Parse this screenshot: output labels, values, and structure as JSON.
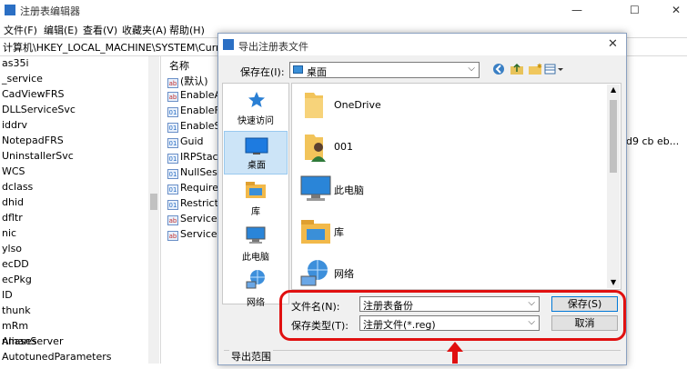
{
  "regedit": {
    "title": "注册表编辑器",
    "menu": [
      "文件(F)",
      "编辑(E)",
      "查看(V)",
      "收藏夹(A)",
      "帮助(H)"
    ],
    "address": "计算机\\HKEY_LOCAL_MACHINE\\SYSTEM\\CurrentCo",
    "tree_items": [
      "as35i",
      "_service",
      "CadViewFRS",
      "DLLServiceSvc",
      "iddrv",
      "NotepadFRS",
      "UninstallerSvc",
      "WCS",
      "dclass",
      "dhid",
      "dfltr",
      "nic",
      "ylso",
      "ecDD",
      "ecPkg",
      "ID",
      "thunk",
      "mRm",
      "nmanServer",
      "Aliases",
      "AutotunedParameters"
    ],
    "values_header": "名称",
    "values": [
      {
        "icon": "ab",
        "name": "(默认)"
      },
      {
        "icon": "ab",
        "name": "EnableA"
      },
      {
        "icon": "reg",
        "name": "EnableF"
      },
      {
        "icon": "reg",
        "name": "EnableS"
      },
      {
        "icon": "reg",
        "name": "Guid"
      },
      {
        "icon": "reg",
        "name": "IRPStack"
      },
      {
        "icon": "reg",
        "name": "NullSess"
      },
      {
        "icon": "reg",
        "name": "RequireS"
      },
      {
        "icon": "reg",
        "name": "RestrictN"
      },
      {
        "icon": "ab",
        "name": "ServiceD"
      },
      {
        "icon": "ab",
        "name": "ServiceD"
      }
    ],
    "data_fragment": "d9 cb eb..."
  },
  "dialog": {
    "title": "导出注册表文件",
    "save_in_label": "保存在(I):",
    "save_in_value": "桌面",
    "places": [
      {
        "label": "快速访问",
        "icon": "star-icon"
      },
      {
        "label": "桌面",
        "icon": "desktop-icon"
      },
      {
        "label": "库",
        "icon": "library-icon"
      },
      {
        "label": "此电脑",
        "icon": "computer-icon"
      },
      {
        "label": "网络",
        "icon": "network-icon"
      }
    ],
    "files": [
      {
        "name": "OneDrive",
        "icon": "folder-icon"
      },
      {
        "name": "001",
        "icon": "user-folder-icon"
      },
      {
        "name": "此电脑",
        "icon": "computer-icon"
      },
      {
        "name": "库",
        "icon": "library-icon"
      },
      {
        "name": "网络",
        "icon": "network-icon"
      }
    ],
    "filename_label": "文件名(N):",
    "filename_value": "注册表备份",
    "filetype_label": "保存类型(T):",
    "filetype_value": "注册文件(*.reg)",
    "save_button": "保存(S)",
    "cancel_button": "取消",
    "export_range_label": "导出范围"
  },
  "colors": {
    "highlight": "#e01010",
    "accent": "#3a8fd8"
  }
}
